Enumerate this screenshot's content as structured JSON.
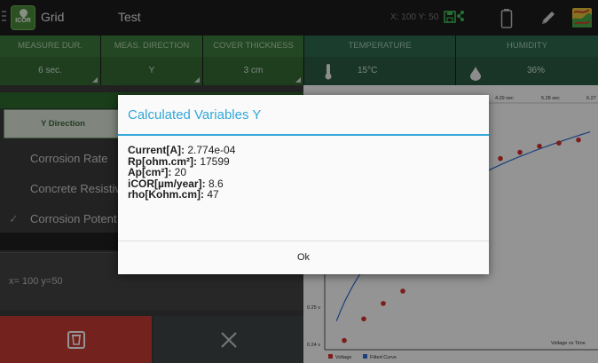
{
  "app": {
    "name": "Grid",
    "logo_text": "ICOR",
    "project": "Test",
    "coordinates": "X: 100 Y: 50"
  },
  "icons": {
    "menu": "menu-icon",
    "save": "save-icon",
    "battery": "battery-icon",
    "pencil": "pencil-icon",
    "map": "map-icon",
    "thermometer": "thermometer-icon",
    "drop": "drop-icon",
    "delete": "delete-icon",
    "close": "close-icon"
  },
  "params": [
    {
      "label": "MEASURE DUR.",
      "value": "6 sec."
    },
    {
      "label": "MEAS. DIRECTION",
      "value": "Y"
    },
    {
      "label": "COVER THICKNESS",
      "value": "3 cm"
    },
    {
      "label": "TEMPERATURE",
      "value": "15°C"
    },
    {
      "label": "HUMIDITY",
      "value": "36%"
    }
  ],
  "left_panel": {
    "direction_button": "Y Direction",
    "items": [
      "Corrosion Rate",
      "Concrete Resistiv",
      "Corrosion Potent"
    ],
    "position": "x= 100 y=50"
  },
  "chart_data": {
    "type": "scatter",
    "x_ticks_top": [
      "4.29 sec",
      "5.28 sec",
      "6.27"
    ],
    "y_ticks": [
      "0.25 v",
      "0.24 v"
    ],
    "title": "Voltage vs Time",
    "legend": [
      "Voltage",
      "Fitted Curve"
    ],
    "colors": {
      "voltage": "#d9312b",
      "fitted": "#2f6fd6"
    },
    "series": [
      {
        "name": "Voltage",
        "points": [
          [
            1,
            0.241
          ],
          [
            2,
            0.248
          ],
          [
            3,
            0.253
          ],
          [
            4,
            0.257
          ],
          [
            6,
            0.272
          ],
          [
            7,
            0.295
          ],
          [
            8,
            0.298
          ],
          [
            9,
            0.3
          ],
          [
            10,
            0.302
          ],
          [
            11,
            0.304
          ],
          [
            12,
            0.305
          ],
          [
            13,
            0.306
          ]
        ]
      }
    ]
  },
  "dialog": {
    "title": "Calculated Variables Y",
    "rows": [
      {
        "label": "Current[A]:",
        "value": " 2.774e-04"
      },
      {
        "label": "Rp[ohm.cm²]:",
        "value": " 17599"
      },
      {
        "label": "Ap[cm²]:",
        "value": " 20"
      },
      {
        "label": "iCOR[µm/year]:",
        "value": " 8.6"
      },
      {
        "label": "rho[Kohm.cm]:",
        "value": " 47"
      }
    ],
    "ok_label": "Ok"
  },
  "colors": {
    "accent": "#33a7d8",
    "param_header": "#2e6a50",
    "delete": "#c93c35"
  }
}
